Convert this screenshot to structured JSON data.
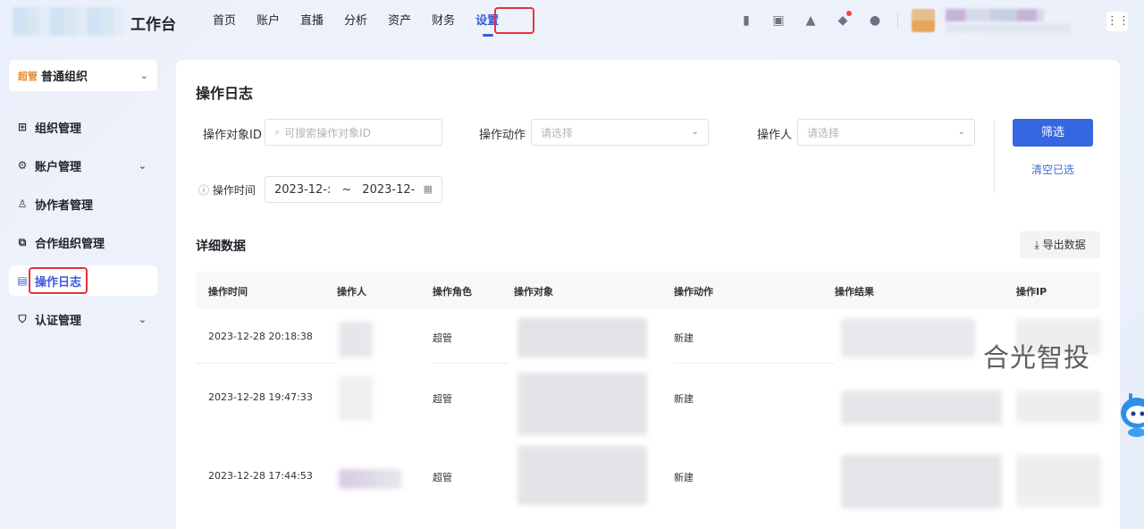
{
  "header": {
    "app_name": "工作台",
    "nav": [
      "首页",
      "账户",
      "直播",
      "分析",
      "资产",
      "财务",
      "设置"
    ],
    "active_nav": "设置"
  },
  "sidebar": {
    "org_tag": "超管",
    "org_name": "普通组织",
    "items": [
      {
        "label": "组织管理",
        "icon": "org-grid-icon"
      },
      {
        "label": "账户管理",
        "icon": "gear-icon",
        "expandable": true
      },
      {
        "label": "协作者管理",
        "icon": "user-icon"
      },
      {
        "label": "合作组织管理",
        "icon": "copy-icon"
      },
      {
        "label": "操作日志",
        "icon": "log-icon",
        "active": true
      },
      {
        "label": "认证管理",
        "icon": "shield-icon",
        "expandable": true
      }
    ]
  },
  "main": {
    "title": "操作日志",
    "filters": {
      "object_id_label": "操作对象ID",
      "object_id_placeholder": "可搜索操作对象ID",
      "action_label": "操作动作",
      "action_placeholder": "请选择",
      "operator_label": "操作人",
      "operator_placeholder": "请选择",
      "time_label": "操作时间",
      "date_start": "2023-12-:",
      "date_sep": "~",
      "date_end": "2023-12-",
      "filter_button": "筛选",
      "clear_link": "清空已选"
    },
    "details_title": "详细数据",
    "export_button": "导出数据",
    "table": {
      "columns": [
        "操作时间",
        "操作人",
        "操作角色",
        "操作对象",
        "操作动作",
        "操作结果",
        "操作IP"
      ],
      "rows": [
        {
          "time": "2023-12-28 20:18:38",
          "role": "超管",
          "action": "新建"
        },
        {
          "time": "2023-12-28 19:47:33",
          "role": "超管",
          "action": "新建"
        },
        {
          "time": "2023-12-28 17:44:53",
          "role": "超管",
          "action": "新建"
        }
      ]
    }
  },
  "watermark_text": "合光智投",
  "colors": {
    "accent": "#3b5bdb",
    "primary_button": "#3467e0",
    "highlight_box": "#e8323c",
    "super_tag": "#e6892e"
  }
}
